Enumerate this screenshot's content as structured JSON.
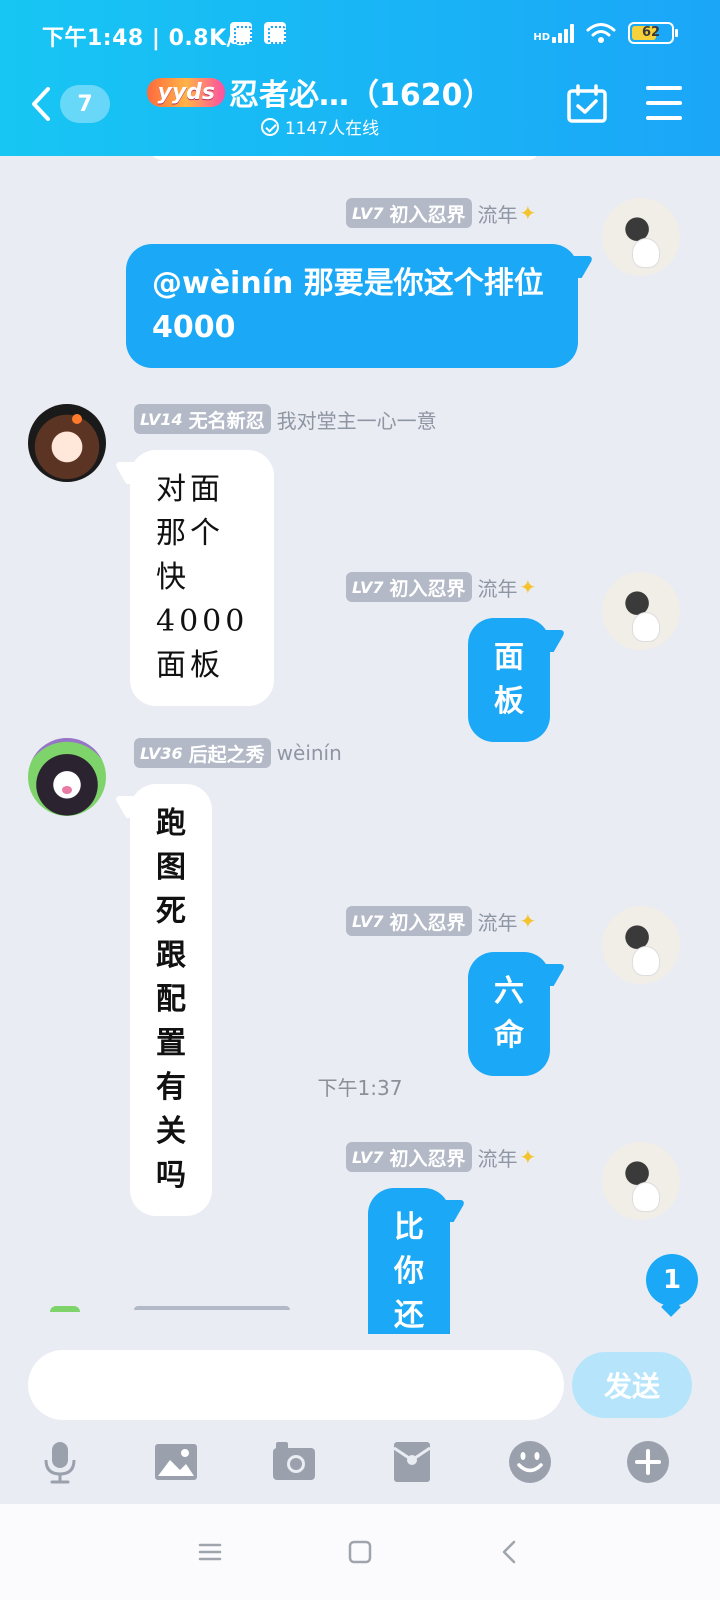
{
  "status_bar": {
    "time": "下午1:48",
    "speed": "0.8K/s",
    "network_label": "HD",
    "battery": "62"
  },
  "header": {
    "unread_count": "7",
    "badge_text": "yyds",
    "group_title": "忍者必…（1620）",
    "online_text": "1147人在线",
    "icons": {
      "back": "back-chevron-icon",
      "calendar": "calendar-check-icon",
      "menu": "menu-icon"
    }
  },
  "colors": {
    "header_start": "#17c6f3",
    "header_end": "#1ba6f8",
    "bubble_out": "#1ba8f6",
    "background": "#eaecf3"
  },
  "messages": [
    {
      "side": "out",
      "level": "LV7",
      "level_title": "初入忍界",
      "sender": "流年",
      "text": "@wèinín 那要是你这个排位4000"
    },
    {
      "side": "in",
      "level": "LV14",
      "level_title": "无名新忍",
      "sender": "我对堂主一心一意",
      "text": "对面那个快4000面板"
    },
    {
      "side": "out",
      "level": "LV7",
      "level_title": "初入忍界",
      "sender": "流年",
      "text": "面板"
    },
    {
      "side": "in",
      "level": "LV36",
      "level_title": "后起之秀",
      "sender": "wèinín",
      "text": "跑图死跟配置有关吗"
    },
    {
      "side": "out",
      "level": "LV7",
      "level_title": "初入忍界",
      "sender": "流年",
      "text": "六命"
    },
    {
      "side": "out",
      "level": "LV7",
      "level_title": "初入忍界",
      "sender": "流年",
      "text": "比你还会玩"
    }
  ],
  "time_divider": "下午1:37",
  "new_message_count": "1",
  "composer": {
    "input_value": "",
    "send_label": "发送",
    "tools": [
      "microphone-icon",
      "image-icon",
      "camera-icon",
      "red-packet-icon",
      "emoji-icon",
      "plus-icon"
    ]
  },
  "navbar": {
    "icons": [
      "recent-apps-icon",
      "home-icon",
      "back-icon"
    ]
  }
}
